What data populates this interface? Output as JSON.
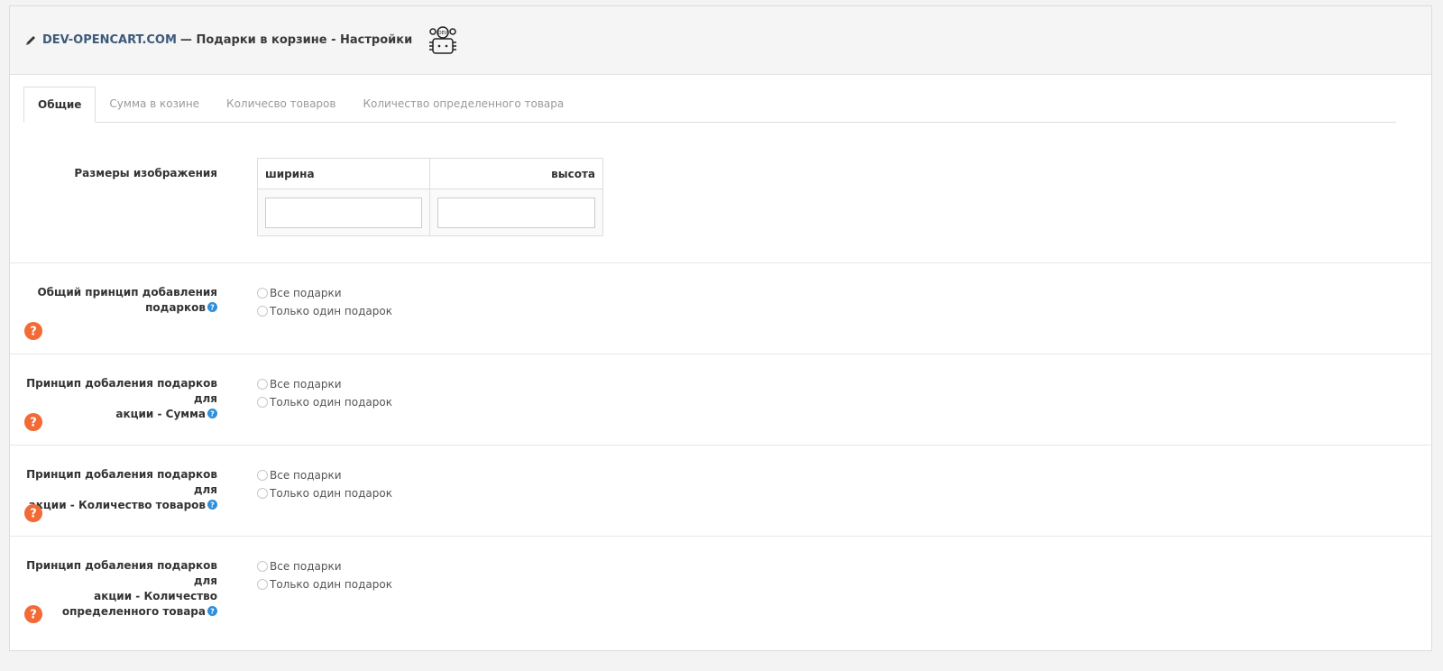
{
  "header": {
    "brand": "DEV-OPENCART.COM",
    "title": "— Подарки в корзине - Настройки",
    "icons": {
      "edit": "pencil-icon",
      "logo": "dev-logo-icon"
    }
  },
  "tabs": [
    {
      "label": "Общие",
      "active": true
    },
    {
      "label": "Сумма в козине",
      "active": false
    },
    {
      "label": "Количесво товаров",
      "active": false
    },
    {
      "label": "Количество определенного товара",
      "active": false
    }
  ],
  "image_size": {
    "label": "Размеры изображения",
    "width_header": "ширина",
    "height_header": "высота",
    "width_value": "",
    "height_value": ""
  },
  "settings": [
    {
      "label_lines": [
        "Общий принцип добавления",
        "подарков"
      ],
      "options": [
        "Все подарки",
        "Только один подарок"
      ],
      "selected": null
    },
    {
      "label_lines": [
        "Принцип добаления подарков для",
        "акции - Сумма"
      ],
      "options": [
        "Все подарки",
        "Только один подарок"
      ],
      "selected": null
    },
    {
      "label_lines": [
        "Принцип добаления подарков для",
        "акции - Количество товаров"
      ],
      "options": [
        "Все подарки",
        "Только один подарок"
      ],
      "selected": null
    },
    {
      "label_lines": [
        "Принцип добаления подарков для",
        "акции - Количество",
        "определенного товара"
      ],
      "options": [
        "Все подарки",
        "Только один подарок"
      ],
      "selected": null
    }
  ],
  "colors": {
    "accent": "#3d5a7a",
    "info": "#2f8fd8",
    "help": "#f26a35"
  }
}
